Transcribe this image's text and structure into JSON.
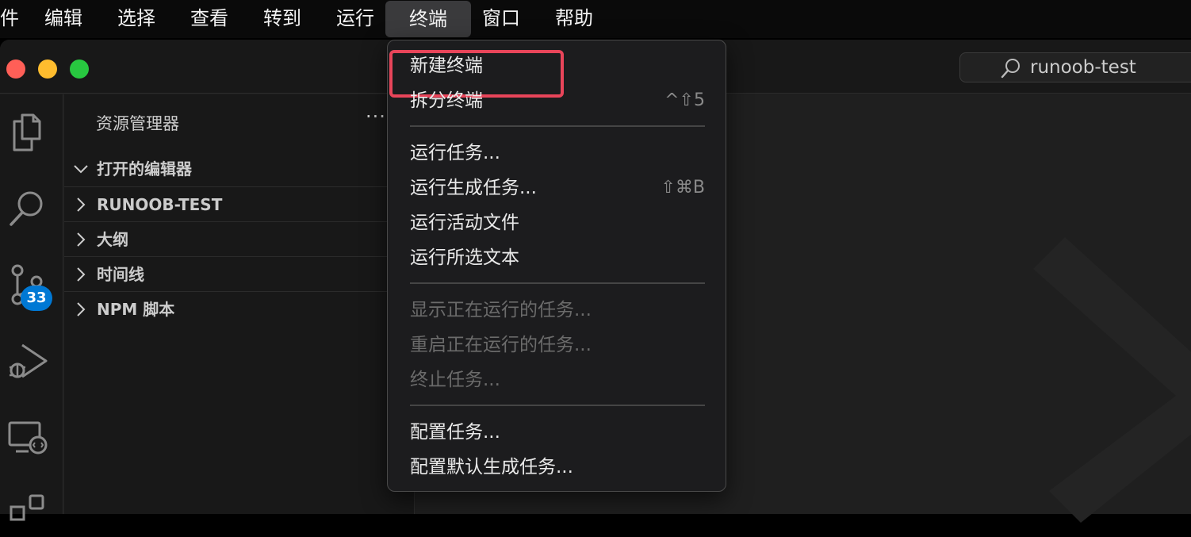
{
  "menubar": {
    "items": [
      {
        "label": "件"
      },
      {
        "label": "编辑"
      },
      {
        "label": "选择"
      },
      {
        "label": "查看"
      },
      {
        "label": "转到"
      },
      {
        "label": "运行"
      },
      {
        "label": "终端",
        "active": true
      },
      {
        "label": "窗口"
      },
      {
        "label": "帮助"
      }
    ]
  },
  "titlebar": {
    "command_center_text": "runoob-test",
    "traffic_lights": {
      "close": "#ff5f57",
      "minimize": "#febc2e",
      "maximize": "#28c840"
    }
  },
  "activitybar": {
    "icons": [
      "files-icon",
      "search-icon",
      "source-control-icon",
      "run-debug-icon",
      "remote-explorer-icon",
      "extensions-icon"
    ],
    "scm_badge": "33",
    "badge_color": "#0078d4"
  },
  "sidebar": {
    "title": "资源管理器",
    "more": "···",
    "sections": [
      {
        "label": "打开的编辑器",
        "expanded": true
      },
      {
        "label": "RUNOOB-TEST",
        "expanded": false
      },
      {
        "label": "大纲",
        "expanded": false
      },
      {
        "label": "时间线",
        "expanded": false
      },
      {
        "label": "NPM 脚本",
        "expanded": false
      }
    ]
  },
  "terminal_menu": {
    "groups": [
      [
        {
          "label": "新建终端",
          "shortcut": "",
          "disabled": false,
          "highlighted": true
        },
        {
          "label": "拆分终端",
          "shortcut": "^⇧5",
          "disabled": false
        }
      ],
      [
        {
          "label": "运行任务...",
          "shortcut": "",
          "disabled": false
        },
        {
          "label": "运行生成任务...",
          "shortcut": "⇧⌘B",
          "disabled": false
        },
        {
          "label": "运行活动文件",
          "shortcut": "",
          "disabled": false
        },
        {
          "label": "运行所选文本",
          "shortcut": "",
          "disabled": false
        }
      ],
      [
        {
          "label": "显示正在运行的任务...",
          "shortcut": "",
          "disabled": true
        },
        {
          "label": "重启正在运行的任务...",
          "shortcut": "",
          "disabled": true
        },
        {
          "label": "终止任务...",
          "shortcut": "",
          "disabled": true
        }
      ],
      [
        {
          "label": "配置任务...",
          "shortcut": "",
          "disabled": false
        },
        {
          "label": "配置默认生成任务...",
          "shortcut": "",
          "disabled": false
        }
      ]
    ],
    "highlight_color": "#e8455a"
  }
}
